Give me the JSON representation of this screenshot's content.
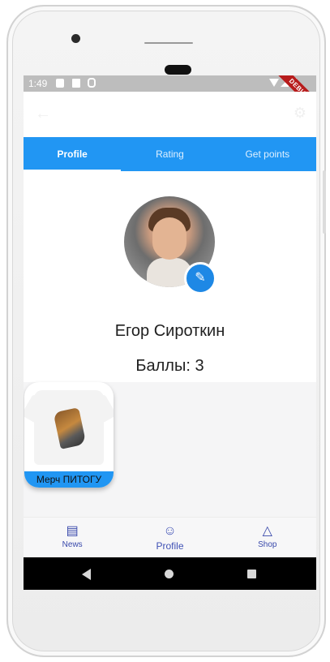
{
  "status_bar": {
    "time": "1:49",
    "debug_label": "DEBUG"
  },
  "app_bar": {
    "back_icon": "arrow-left-icon",
    "settings_icon": "gear-icon"
  },
  "tabs": [
    {
      "label": "Profile",
      "active": true
    },
    {
      "label": "Rating",
      "active": false
    },
    {
      "label": "Get points",
      "active": false
    }
  ],
  "profile": {
    "name": "Егор Сироткин",
    "points_text": "Баллы: 3",
    "edit_icon": "pencil-icon"
  },
  "products": [
    {
      "label": "Мерч ПИТОГУ"
    }
  ],
  "bottom_nav": [
    {
      "label": "News",
      "icon": "newspaper-icon",
      "active": false
    },
    {
      "label": "Profile",
      "icon": "person-circle-icon",
      "active": true
    },
    {
      "label": "Shop",
      "icon": "basket-icon",
      "active": false
    }
  ],
  "colors": {
    "primary": "#2196f3",
    "nav_accent": "#3f51b5",
    "edit_badge": "#1e88e5"
  }
}
